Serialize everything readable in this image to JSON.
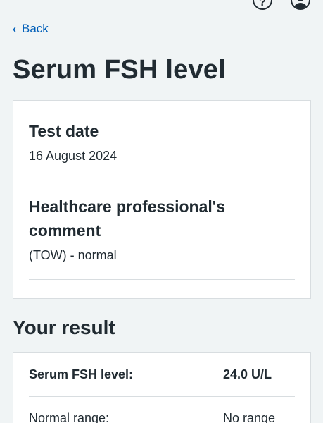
{
  "header": {
    "icons": [
      "help-icon",
      "account-icon"
    ],
    "help_glyph": "?"
  },
  "nav": {
    "back_label": "Back"
  },
  "page": {
    "title": "Serum FSH level"
  },
  "details": {
    "test_date_label": "Test date",
    "test_date_value": "16 August 2024",
    "comment_label": "Healthcare professional's comment",
    "comment_value": "(TOW) - normal"
  },
  "result": {
    "section_title": "Your result",
    "rows": [
      {
        "label": "Serum FSH level:",
        "value": "24.0 U/L"
      },
      {
        "label": "Normal range:",
        "value": "No range"
      }
    ]
  },
  "colors": {
    "link": "#005eb8",
    "background": "#f0f4f5",
    "text": "#212b32"
  }
}
